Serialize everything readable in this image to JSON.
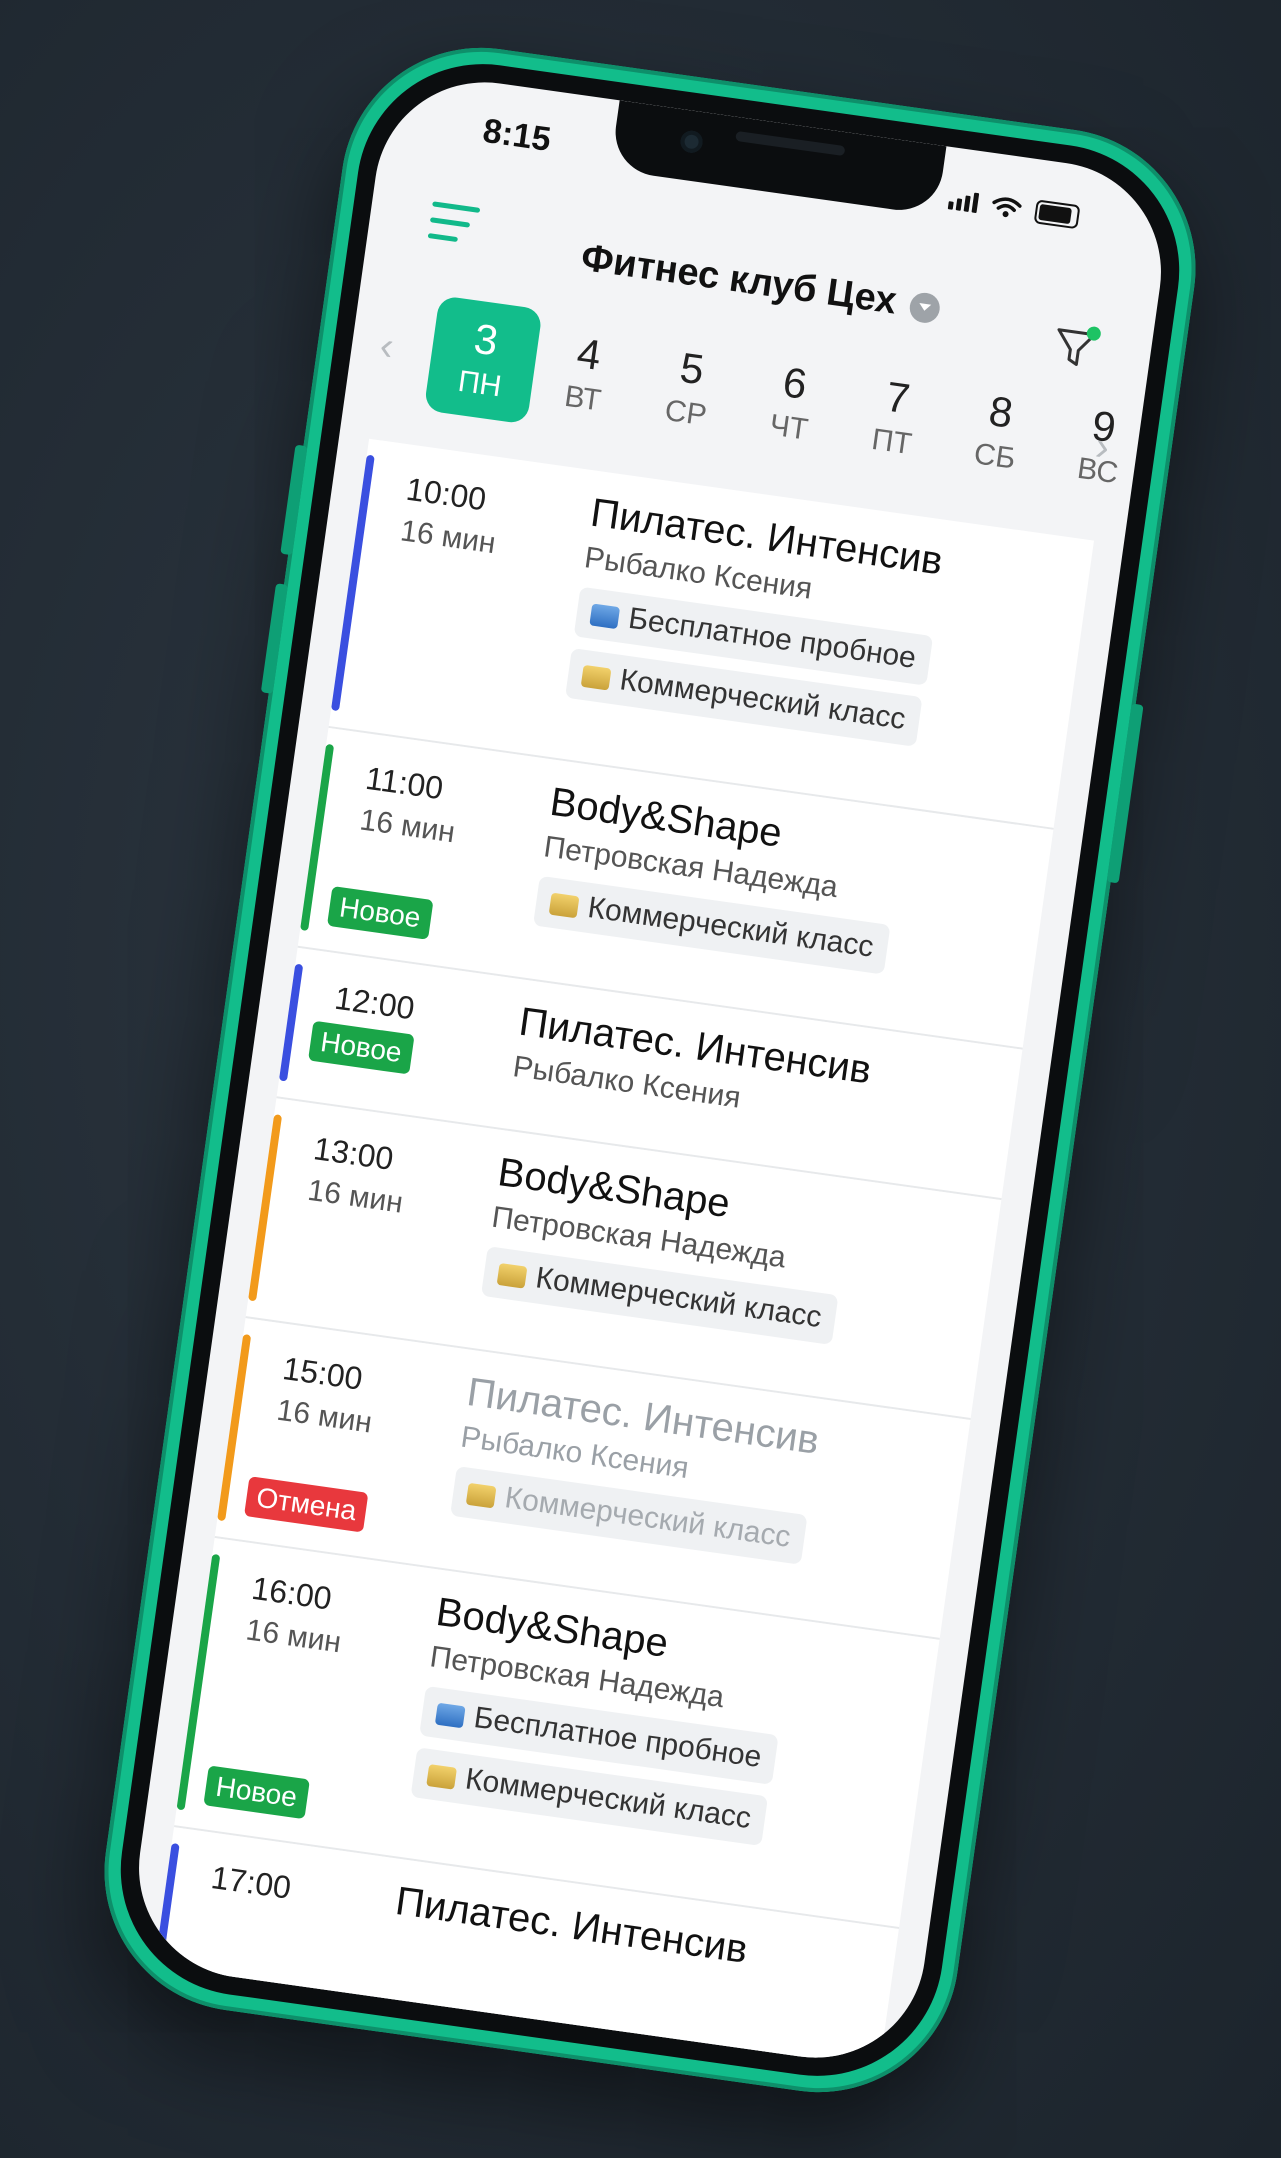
{
  "status": {
    "time": "8:15"
  },
  "header": {
    "title": "Фитнес клуб Цех"
  },
  "days": [
    {
      "num": "3",
      "wd": "ПН",
      "active": true
    },
    {
      "num": "4",
      "wd": "ВТ"
    },
    {
      "num": "5",
      "wd": "СР"
    },
    {
      "num": "6",
      "wd": "ЧТ"
    },
    {
      "num": "7",
      "wd": "ПТ"
    },
    {
      "num": "8",
      "wd": "СБ"
    },
    {
      "num": "9",
      "wd": "ВС"
    }
  ],
  "colors": {
    "accent": "#12bd8b",
    "blue": "#3a4fe0",
    "green": "#1aa548",
    "orange": "#f29a1b",
    "red": "#e8383d"
  },
  "classes": [
    {
      "time": "10:00",
      "duration": "16 мин",
      "title": "Пилатес. Интенсив",
      "coach": "Рыбалко Ксения",
      "color": "blue",
      "tags": [
        "Бесплатное пробное",
        "Коммерческий класс"
      ],
      "tag_icons": [
        "free",
        "cash"
      ]
    },
    {
      "time": "11:00",
      "duration": "16 мин",
      "title": "Body&Shape",
      "coach": "Петровская Надежда",
      "color": "green",
      "badge": "Новое",
      "tags": [
        "Коммерческий класс"
      ],
      "tag_icons": [
        "cash"
      ]
    },
    {
      "time": "12:00",
      "title": "Пилатес. Интенсив",
      "coach": "Рыбалко Ксения",
      "color": "blue",
      "badge": "Новое",
      "tags": []
    },
    {
      "time": "13:00",
      "duration": "16 мин",
      "title": "Body&Shape",
      "coach": "Петровская Надежда",
      "color": "orange",
      "tags": [
        "Коммерческий класс"
      ],
      "tag_icons": [
        "cash"
      ]
    },
    {
      "time": "15:00",
      "duration": "16 мин",
      "title": "Пилатес. Интенсив",
      "coach": "Рыбалко Ксения",
      "color": "orange",
      "badge": "Отмена",
      "cancelled": true,
      "tags": [
        "Коммерческий класс"
      ],
      "tag_icons": [
        "cash"
      ]
    },
    {
      "time": "16:00",
      "duration": "16 мин",
      "title": "Body&Shape",
      "coach": "Петровская Надежда",
      "color": "green",
      "badge": "Новое",
      "tags": [
        "Бесплатное пробное",
        "Коммерческий класс"
      ],
      "tag_icons": [
        "free",
        "cash"
      ]
    },
    {
      "time": "17:00",
      "title": "Пилатес. Интенсив",
      "color": "blue",
      "tags": []
    }
  ]
}
